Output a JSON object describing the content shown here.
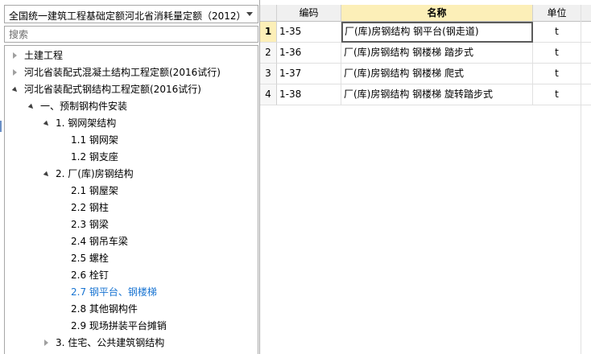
{
  "dropdown": {
    "selected": "全国统一建筑工程基础定额河北省消耗量定额（2012）"
  },
  "search": {
    "placeholder": "搜索"
  },
  "tree": {
    "items": [
      {
        "label": "土建工程",
        "state": "collapsed",
        "level": 0
      },
      {
        "label": "河北省装配式混凝土结构工程定额(2016试行)",
        "state": "collapsed",
        "level": 0
      },
      {
        "label": "河北省装配式钢结构工程定额(2016试行)",
        "state": "expanded",
        "level": 0
      },
      {
        "label": "一、预制钢构件安装",
        "state": "expanded",
        "level": 1
      },
      {
        "label": "1. 钢网架结构",
        "state": "expanded",
        "level": 2
      },
      {
        "label": "1.1 钢网架",
        "state": "leaf",
        "level": 3
      },
      {
        "label": "1.2 钢支座",
        "state": "leaf",
        "level": 3
      },
      {
        "label": "2. 厂(库)房钢结构",
        "state": "expanded",
        "level": 2
      },
      {
        "label": "2.1 钢屋架",
        "state": "leaf",
        "level": 3
      },
      {
        "label": "2.2 钢柱",
        "state": "leaf",
        "level": 3
      },
      {
        "label": "2.3 钢梁",
        "state": "leaf",
        "level": 3
      },
      {
        "label": "2.4 钢吊车梁",
        "state": "leaf",
        "level": 3
      },
      {
        "label": "2.5 螺栓",
        "state": "leaf",
        "level": 3
      },
      {
        "label": "2.6 栓钉",
        "state": "leaf",
        "level": 3
      },
      {
        "label": "2.7 钢平台、钢楼梯",
        "state": "leaf",
        "level": 3,
        "selected": true
      },
      {
        "label": "2.8 其他钢构件",
        "state": "leaf",
        "level": 3
      },
      {
        "label": "2.9 现场拼装平台摊销",
        "state": "leaf",
        "level": 3
      },
      {
        "label": "3. 住宅、公共建筑钢结构",
        "state": "collapsed",
        "level": 2
      }
    ]
  },
  "grid": {
    "headers": {
      "code": "编码",
      "name": "名称",
      "unit": "单位"
    },
    "rows": [
      {
        "num": "1",
        "code": "1-35",
        "name": "厂(库)房钢结构 钢平台(钢走道)",
        "unit": "t"
      },
      {
        "num": "2",
        "code": "1-36",
        "name": "厂(库)房钢结构 钢楼梯 踏步式",
        "unit": "t"
      },
      {
        "num": "3",
        "code": "1-37",
        "name": "厂(库)房钢结构 钢楼梯 爬式",
        "unit": "t"
      },
      {
        "num": "4",
        "code": "1-38",
        "name": "厂(库)房钢结构 钢楼梯 旋转踏步式",
        "unit": "t"
      }
    ]
  },
  "colors": {
    "selected_text": "#1874d2",
    "header_highlight": "#fcefb8",
    "border": "#a7a7a7"
  },
  "icons": {
    "expanded": "triangle-down-icon",
    "collapsed": "triangle-right-icon",
    "dropdown": "chevron-down-icon"
  }
}
